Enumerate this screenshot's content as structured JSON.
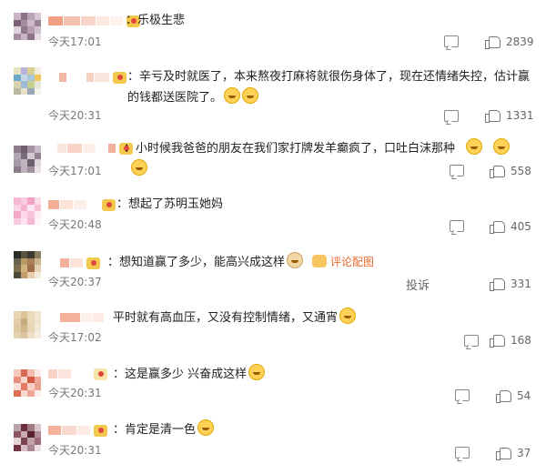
{
  "comments": [
    {
      "text": "：乐极生悲",
      "time": "今天17:01",
      "likes": "2839"
    },
    {
      "text": "：辛亏及时就医了，本来熬夜打麻将就很伤身体了，现在还情绪失控，估计赢的钱都送医院了。",
      "time": "今天20:31",
      "likes": "1331"
    },
    {
      "text": "：小时候我爸爸的朋友在我们家打牌发羊癫疯了，口吐白沫那种",
      "time": "今天17:01",
      "likes": "558"
    },
    {
      "text": "：想起了苏明玉她妈",
      "time": "今天20:48",
      "likes": "405"
    },
    {
      "text": "：想知道赢了多少，能高兴成这样",
      "time": "今天20:37",
      "likes": "331",
      "extra": "评论配图",
      "complain": "投诉"
    },
    {
      "text": "平时就有高血压，又没有控制情绪，又通宵",
      "time": "今天17:02",
      "likes": "168"
    },
    {
      "text": "：这是赢多少 兴奋成这样",
      "time": "今天20:31",
      "likes": "54"
    },
    {
      "text": "：肯定是清一色",
      "time": "今天20:31",
      "likes": "37"
    }
  ],
  "colors": {
    "accent": "#e8692e",
    "muted": "#777777"
  }
}
